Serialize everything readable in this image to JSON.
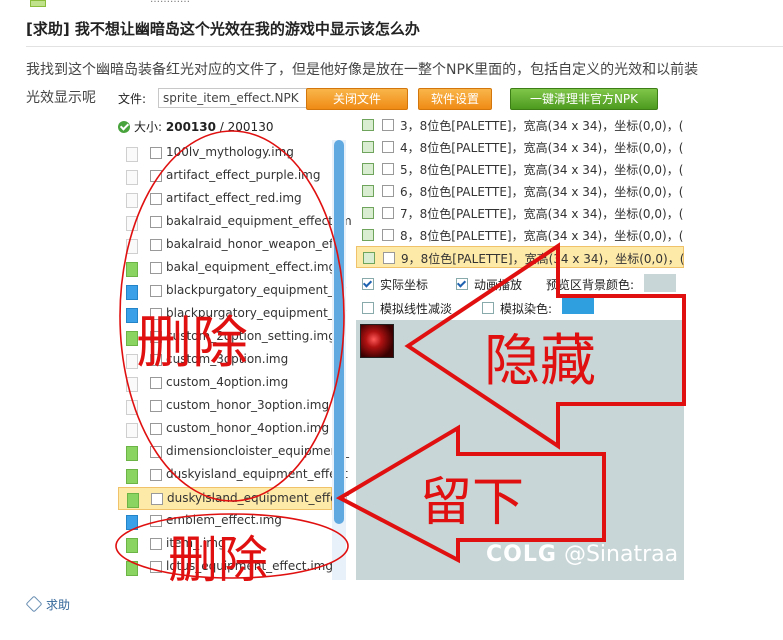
{
  "topstrip": {
    "text": "…………"
  },
  "post": {
    "title": "[求助] 我不想让幽暗岛这个光效在我的游戏中显示该怎么办",
    "body_line1": "我找到这个幽暗岛装备红光对应的文件了，但是他好像是放在一整个NPK里面的，包括自定义的光效和以前装",
    "body_line2": "光效显示呢"
  },
  "app": {
    "file_label": "文件:",
    "file_value": "sprite_item_effect.NPK",
    "buttons": {
      "close": "关闭文件",
      "settings": "软件设置",
      "clean": "一键清理非官方NPK"
    },
    "size_label": "大小:",
    "size_current": "200130",
    "size_sep": " / ",
    "size_total": "200130",
    "files": [
      {
        "name": "100lv_mythology.img",
        "icon": "blank-file"
      },
      {
        "name": "artifact_effect_purple.img",
        "icon": "blank-file"
      },
      {
        "name": "artifact_effect_red.img",
        "icon": "blank-file"
      },
      {
        "name": "bakalraid_equipment_effect.im",
        "icon": "blank-file"
      },
      {
        "name": "bakalraid_honor_weapon_effe",
        "icon": "blank-file"
      },
      {
        "name": "bakal_equipment_effect.img",
        "icon": "green-file"
      },
      {
        "name": "blackpurgatory_equipment_or",
        "icon": "blue-file"
      },
      {
        "name": "blackpurgatory_equipment_or",
        "icon": "blue-file"
      },
      {
        "name": "custom_2option_setting.img",
        "icon": "green-file"
      },
      {
        "name": "custom_3option.img",
        "icon": "blank-file"
      },
      {
        "name": "custom_4option.img",
        "icon": "blank-file"
      },
      {
        "name": "custom_honor_3option.img",
        "icon": "blank-file"
      },
      {
        "name": "custom_honor_4option.img",
        "icon": "blank-file"
      },
      {
        "name": "dimensioncloister_equipment_",
        "icon": "green-file"
      },
      {
        "name": "duskyisland_equipment_effect",
        "icon": "green-file"
      },
      {
        "name": "duskyisland_equipment_effect",
        "icon": "green-file",
        "selected": true
      },
      {
        "name": "emblem_effect.img",
        "icon": "blue-file"
      },
      {
        "name": "item_.img",
        "icon": "green-file"
      },
      {
        "name": "lotus_equipment_effect.img",
        "icon": "green-file"
      }
    ],
    "frames": [
      {
        "text": "3，8位色[PALETTE]，宽高(34 x 34)，坐标(0,0)，("
      },
      {
        "text": "4，8位色[PALETTE]，宽高(34 x 34)，坐标(0,0)，("
      },
      {
        "text": "5，8位色[PALETTE]，宽高(34 x 34)，坐标(0,0)，("
      },
      {
        "text": "6，8位色[PALETTE]，宽高(34 x 34)，坐标(0,0)，("
      },
      {
        "text": "7，8位色[PALETTE]，宽高(34 x 34)，坐标(0,0)，("
      },
      {
        "text": "8，8位色[PALETTE]，宽高(34 x 34)，坐标(0,0)，("
      },
      {
        "text": "9，8位色[PALETTE]，宽高(34 x 34)，坐标(0,0)，(",
        "selected": true
      }
    ],
    "options": {
      "actual_coords": "实际坐标",
      "animate": "动画播放",
      "bg_color_label": "预览区背景颜色:",
      "bg_color": "#c8d6d7",
      "linear_fade": "模拟线性减淡",
      "dye": "模拟染色:",
      "dye_color": "#2f9fe0"
    },
    "watermark_brand": "COLG",
    "watermark_user": "@Sinatraa"
  },
  "annotations": {
    "delete_top": "删除",
    "hide": "隐藏",
    "keep": "留下",
    "delete_bottom": "删除",
    "color": "#e01010"
  },
  "tag": {
    "label": "求助"
  }
}
